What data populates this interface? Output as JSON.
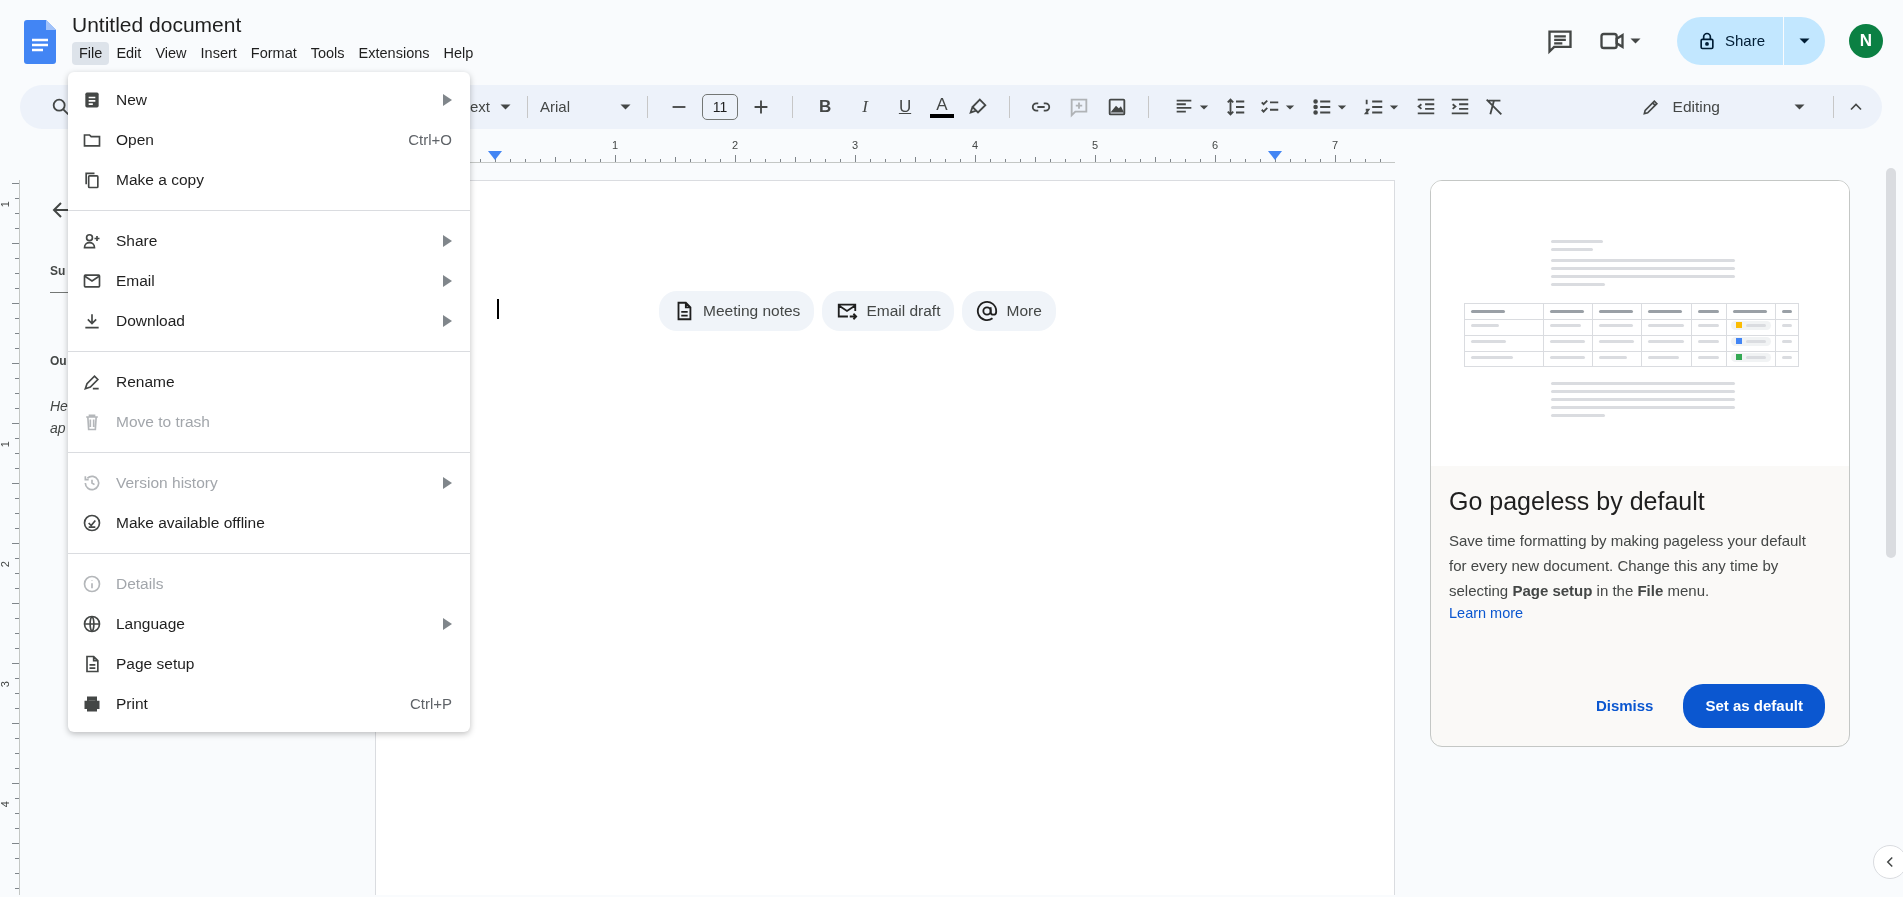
{
  "document": {
    "title": "Untitled document"
  },
  "menubar": [
    {
      "label": "File",
      "selected": true
    },
    {
      "label": "Edit",
      "selected": false
    },
    {
      "label": "View",
      "selected": false
    },
    {
      "label": "Insert",
      "selected": false
    },
    {
      "label": "Format",
      "selected": false
    },
    {
      "label": "Tools",
      "selected": false
    },
    {
      "label": "Extensions",
      "selected": false
    },
    {
      "label": "Help",
      "selected": false
    }
  ],
  "header_actions": {
    "share_label": "Share",
    "avatar_initial": "N"
  },
  "toolbar": {
    "style": "ext",
    "font": "Arial",
    "font_size": "11",
    "format_buttons": [
      "B",
      "I",
      "U",
      "A"
    ],
    "comment_disabled": true,
    "mode": "Editing"
  },
  "ruler": {
    "horizontal": [
      "1",
      "2",
      "3",
      "4",
      "5",
      "6",
      "7"
    ],
    "vertical": [
      "1",
      "1",
      "2",
      "3",
      "4"
    ]
  },
  "sidebar": {
    "fragments": [
      {
        "text": "Su",
        "kind": "heading"
      },
      {
        "text": "Ou",
        "kind": "heading"
      },
      {
        "text": "He",
        "kind": "hint"
      },
      {
        "text": "ap",
        "kind": "hint"
      }
    ]
  },
  "file_menu": {
    "sections": [
      {
        "items": [
          {
            "label": "New",
            "submenu": true,
            "disabled": false
          },
          {
            "label": "Open",
            "shortcut": "Ctrl+O",
            "submenu": false,
            "disabled": false
          },
          {
            "label": "Make a copy",
            "submenu": false,
            "disabled": false
          }
        ]
      },
      {
        "items": [
          {
            "label": "Share",
            "submenu": true,
            "disabled": false
          },
          {
            "label": "Email",
            "submenu": true,
            "disabled": false
          },
          {
            "label": "Download",
            "submenu": true,
            "disabled": false
          }
        ]
      },
      {
        "items": [
          {
            "label": "Rename",
            "submenu": false,
            "disabled": false
          },
          {
            "label": "Move to trash",
            "submenu": false,
            "disabled": true
          }
        ]
      },
      {
        "items": [
          {
            "label": "Version history",
            "submenu": true,
            "disabled": true
          },
          {
            "label": "Make available offline",
            "submenu": false,
            "disabled": false
          }
        ]
      },
      {
        "items": [
          {
            "label": "Details",
            "submenu": false,
            "disabled": true
          },
          {
            "label": "Language",
            "submenu": true,
            "disabled": false
          },
          {
            "label": "Page setup",
            "submenu": false,
            "disabled": false
          },
          {
            "label": "Print",
            "shortcut": "Ctrl+P",
            "submenu": false,
            "disabled": false
          }
        ]
      }
    ]
  },
  "template_chips": [
    {
      "label": "Meeting notes"
    },
    {
      "label": "Email draft"
    },
    {
      "label": "More"
    }
  ],
  "pageless_card": {
    "title": "Go pageless by default",
    "body": "Save time formatting by making pageless your default for every new document. Change this any time by selecting **Page setup** in the **File** menu.",
    "link": "Learn more",
    "dismiss": "Dismiss",
    "confirm": "Set as default"
  }
}
